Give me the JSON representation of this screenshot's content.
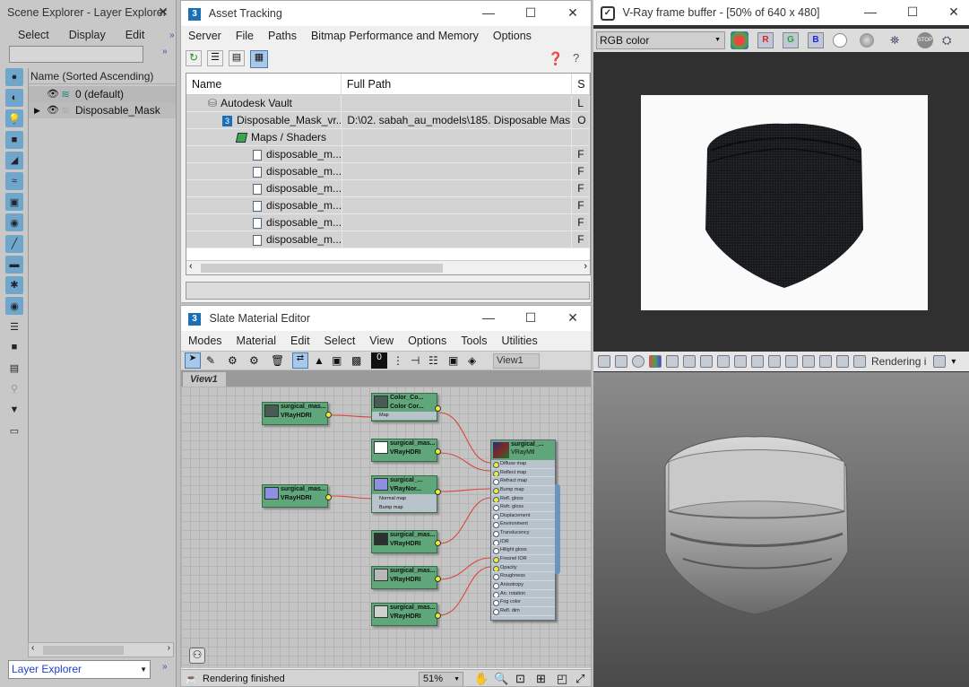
{
  "scene_explorer": {
    "title": "Scene Explorer - Layer Explorer",
    "menu": [
      "Select",
      "Display",
      "Edit"
    ],
    "column_header": "Name (Sorted Ascending)",
    "layers": [
      "0 (default)",
      "Disposable_Mask"
    ],
    "bottom_dropdown": "Layer Explorer"
  },
  "asset_tracking": {
    "title": "Asset Tracking",
    "menu": [
      "Server",
      "File",
      "Paths",
      "Bitmap Performance and Memory",
      "Options"
    ],
    "columns": [
      "Name",
      "Full Path",
      "S"
    ],
    "rows": [
      {
        "name": "Autodesk Vault",
        "path": "",
        "status": "L"
      },
      {
        "name": "Disposable_Mask_vr...",
        "path": "D:\\02. sabah_au_models\\185. Disposable Mas...",
        "status": "O"
      },
      {
        "name": "Maps / Shaders",
        "path": "",
        "status": ""
      },
      {
        "name": "disposable_m...",
        "path": "",
        "status": "F"
      },
      {
        "name": "disposable_m...",
        "path": "",
        "status": "F"
      },
      {
        "name": "disposable_m...",
        "path": "",
        "status": "F"
      },
      {
        "name": "disposable_m...",
        "path": "",
        "status": "F"
      },
      {
        "name": "disposable_m...",
        "path": "",
        "status": "F"
      },
      {
        "name": "disposable_m...",
        "path": "",
        "status": "F"
      }
    ]
  },
  "slate": {
    "title": "Slate Material Editor",
    "menu": [
      "Modes",
      "Material",
      "Edit",
      "Select",
      "View",
      "Options",
      "Tools",
      "Utilities"
    ],
    "view_dropdown": "View1",
    "tab": "View1",
    "status": "Rendering finished",
    "zoom": "51%",
    "nodes": [
      {
        "title": "surgical_mas...",
        "sub": "VRayHDRI",
        "swatch": "#4a5a55",
        "ports": []
      },
      {
        "title": "Color_Co...",
        "sub": "Color Cor...",
        "swatch": "#4a5a55",
        "ports": [
          "Map"
        ]
      },
      {
        "title": "surgical_mas...",
        "sub": "VRayHDRI",
        "swatch": "#ffffff",
        "ports": []
      },
      {
        "title": "surgical_mas...",
        "sub": "VRayHDRI",
        "swatch": "#8f8fe0",
        "ports": []
      },
      {
        "title": "surgical_...",
        "sub": "VRayNor...",
        "swatch": "#8f8fe0",
        "ports": [
          "Normal map",
          "Bump map"
        ]
      },
      {
        "title": "surgical_mas...",
        "sub": "VRayHDRI",
        "swatch": "#2c3030",
        "ports": []
      },
      {
        "title": "surgical_mas...",
        "sub": "VRayHDRI",
        "swatch": "#b8b8b8",
        "ports": []
      },
      {
        "title": "surgical_mas...",
        "sub": "VRayHDRI",
        "swatch": "#d0d0d0",
        "ports": []
      }
    ],
    "material": {
      "title": "surgical_...",
      "sub": "VRayMtl",
      "slots": [
        "Diffuse map",
        "Reflect map",
        "Refract map",
        "Bump map",
        "Refl. gloss",
        "Refr. gloss",
        "Displacement",
        "Environment",
        "Translucency",
        "IOR",
        "Hilight gloss",
        "Fresnel IOR",
        "Opacity",
        "Roughness",
        "Anisotropy",
        "An. rotation",
        "Fog color",
        "Refl. dim"
      ]
    }
  },
  "vfb": {
    "title": "V-Ray frame buffer - [50% of 640 x 480]",
    "channel": "RGB color",
    "status": "Rendering i"
  }
}
